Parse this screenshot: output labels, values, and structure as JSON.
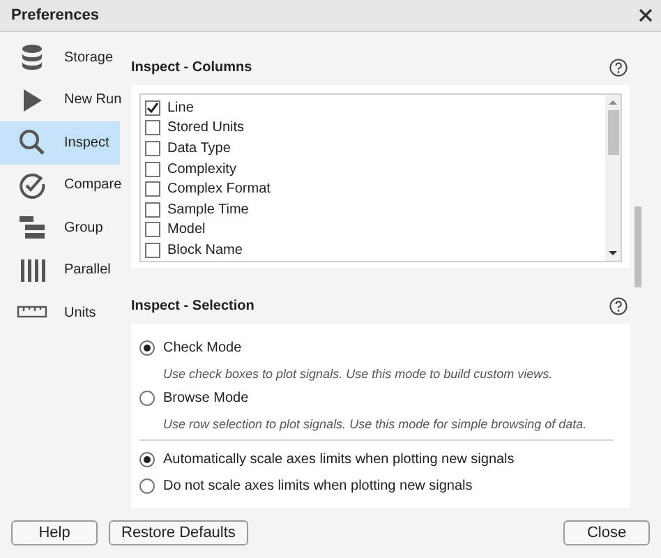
{
  "window": {
    "title": "Preferences"
  },
  "sidebar": {
    "items": [
      {
        "label": "Storage",
        "selected": false
      },
      {
        "label": "New Run",
        "selected": false
      },
      {
        "label": "Inspect",
        "selected": true
      },
      {
        "label": "Compare",
        "selected": false
      },
      {
        "label": "Group",
        "selected": false
      },
      {
        "label": "Parallel",
        "selected": false
      },
      {
        "label": "Units",
        "selected": false
      }
    ]
  },
  "columns_section": {
    "title": "Inspect - Columns",
    "items": [
      {
        "label": "Line",
        "checked": true
      },
      {
        "label": "Stored Units",
        "checked": false
      },
      {
        "label": "Data Type",
        "checked": false
      },
      {
        "label": "Complexity",
        "checked": false
      },
      {
        "label": "Complex Format",
        "checked": false
      },
      {
        "label": "Sample Time",
        "checked": false
      },
      {
        "label": "Model",
        "checked": false
      },
      {
        "label": "Block Name",
        "checked": false
      }
    ]
  },
  "selection_section": {
    "title": "Inspect - Selection",
    "mode_options": [
      {
        "label": "Check Mode",
        "selected": true,
        "description": "Use check boxes to plot signals. Use this mode to build custom views."
      },
      {
        "label": "Browse Mode",
        "selected": false,
        "description": "Use row selection to plot signals. Use this mode for simple browsing of data."
      }
    ],
    "scale_options": [
      {
        "label": "Automatically scale axes limits when plotting new signals",
        "selected": true
      },
      {
        "label": "Do not scale axes limits when plotting new signals",
        "selected": false
      }
    ]
  },
  "buttons": {
    "left": [
      "Help",
      "Restore Defaults"
    ],
    "right": [
      "Close"
    ]
  }
}
